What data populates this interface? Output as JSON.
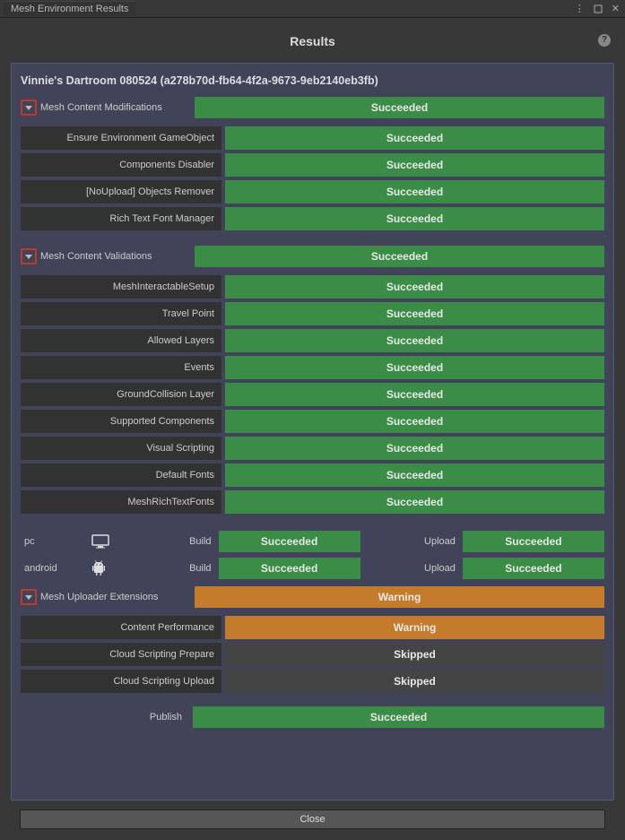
{
  "window": {
    "title": "Mesh Environment Results"
  },
  "header": {
    "title": "Results"
  },
  "project": "Vinnie's Dartroom 080524 (a278b70d-fb64-4f2a-9673-9eb2140eb3fb)",
  "status": {
    "succeeded": "Succeeded",
    "warning": "Warning",
    "skipped": "Skipped"
  },
  "sections": {
    "modifications": {
      "label": "Mesh Content Modifications",
      "status": "succeeded",
      "items": [
        {
          "label": "Ensure Environment GameObject",
          "status": "succeeded"
        },
        {
          "label": "Components Disabler",
          "status": "succeeded"
        },
        {
          "label": "[NoUpload] Objects Remover",
          "status": "succeeded"
        },
        {
          "label": "Rich Text Font Manager",
          "status": "succeeded"
        }
      ]
    },
    "validations": {
      "label": "Mesh Content Validations",
      "status": "succeeded",
      "items": [
        {
          "label": "MeshInteractableSetup",
          "status": "succeeded"
        },
        {
          "label": "Travel Point",
          "status": "succeeded"
        },
        {
          "label": "Allowed Layers",
          "status": "succeeded"
        },
        {
          "label": "Events",
          "status": "succeeded"
        },
        {
          "label": "GroundCollision Layer",
          "status": "succeeded"
        },
        {
          "label": "Supported Components",
          "status": "succeeded"
        },
        {
          "label": "Visual Scripting",
          "status": "succeeded"
        },
        {
          "label": "Default Fonts",
          "status": "succeeded"
        },
        {
          "label": "MeshRichTextFonts",
          "status": "succeeded"
        }
      ]
    },
    "uploader": {
      "label": "Mesh Uploader Extensions",
      "status": "warning",
      "items": [
        {
          "label": "Content Performance",
          "status": "warning"
        },
        {
          "label": "Cloud Scripting Prepare",
          "status": "skipped"
        },
        {
          "label": "Cloud Scripting Upload",
          "status": "skipped"
        }
      ]
    }
  },
  "platforms": [
    {
      "name": "pc",
      "icon": "monitor",
      "build_label": "Build",
      "build_status": "succeeded",
      "upload_label": "Upload",
      "upload_status": "succeeded"
    },
    {
      "name": "android",
      "icon": "android",
      "build_label": "Build",
      "build_status": "succeeded",
      "upload_label": "Upload",
      "upload_status": "succeeded"
    }
  ],
  "publish": {
    "label": "Publish",
    "status": "succeeded"
  },
  "buttons": {
    "close": "Close"
  }
}
